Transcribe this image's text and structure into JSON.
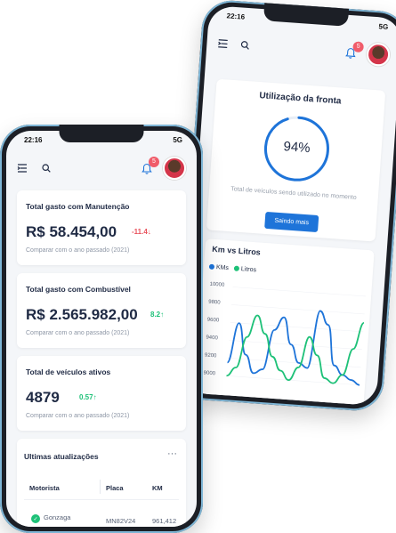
{
  "back_phone": {
    "status": {
      "time": "22:16",
      "signal": "5G"
    },
    "notification_count": "5",
    "utilization": {
      "title": "Utilização da fronta",
      "percent_text": "94%",
      "percent": 94,
      "description": "Total de veículos sendo utilizado no momento",
      "button": "Saindo mais"
    },
    "km_chart": {
      "title": "Km vs Litros",
      "y_ticks": [
        "10000",
        "9800",
        "9600",
        "9400",
        "9200",
        "9000"
      ],
      "legend": [
        "KMs",
        "Litros"
      ]
    }
  },
  "front_phone": {
    "status": {
      "time": "22:16",
      "signal": "5G"
    },
    "notification_count": "5",
    "cards": [
      {
        "title": "Total gasto com Manutenção",
        "value": "R$ 58.454,00",
        "change": "-11.4",
        "direction": "down",
        "subtitle": "Comparar com o ano passado (2021)"
      },
      {
        "title": "Total gasto com Combustível",
        "value": "R$ 2.565.982,00",
        "change": "8.2",
        "direction": "up",
        "subtitle": "Comparar com o ano passado (2021)"
      },
      {
        "title": "Total de veículos ativos",
        "value": "4879",
        "change": "0.57",
        "direction": "up",
        "subtitle": "Comparar com o ano passado (2021)"
      }
    ],
    "updates": {
      "title": "Ultimas atualizações",
      "more": "···",
      "columns": [
        "Motorista",
        "Placa",
        "KM"
      ],
      "rows": [
        {
          "driver": "Gonzaga",
          "plate": "MN82V24",
          "km": "961,412"
        }
      ]
    }
  },
  "colors": {
    "accent": "#1e74d9",
    "kms_series": "#1e74d9",
    "litros_series": "#1ec178",
    "negative": "#e8505b",
    "positive": "#1ec178",
    "badge": "#f05c6a"
  },
  "chart_data": {
    "type": "line",
    "title": "Km vs Litros",
    "ylim": [
      9000,
      10000
    ],
    "y_ticks": [
      10000,
      9800,
      9600,
      9400,
      9200,
      9000
    ],
    "x": [
      0,
      1,
      2,
      3,
      4,
      5,
      6,
      7,
      8,
      9,
      10,
      11,
      12,
      13,
      14,
      15
    ],
    "series": [
      {
        "name": "KMs",
        "values": [
          9150,
          9600,
          9250,
          9050,
          9100,
          9550,
          9700,
          9400,
          9200,
          9150,
          9800,
          9650,
          9200,
          9100,
          9050,
          9000
        ]
      },
      {
        "name": "Litros",
        "values": [
          9000,
          9100,
          9450,
          9700,
          9500,
          9250,
          9100,
          9000,
          9150,
          9500,
          9300,
          9050,
          9000,
          9100,
          9400,
          9700
        ]
      }
    ]
  }
}
